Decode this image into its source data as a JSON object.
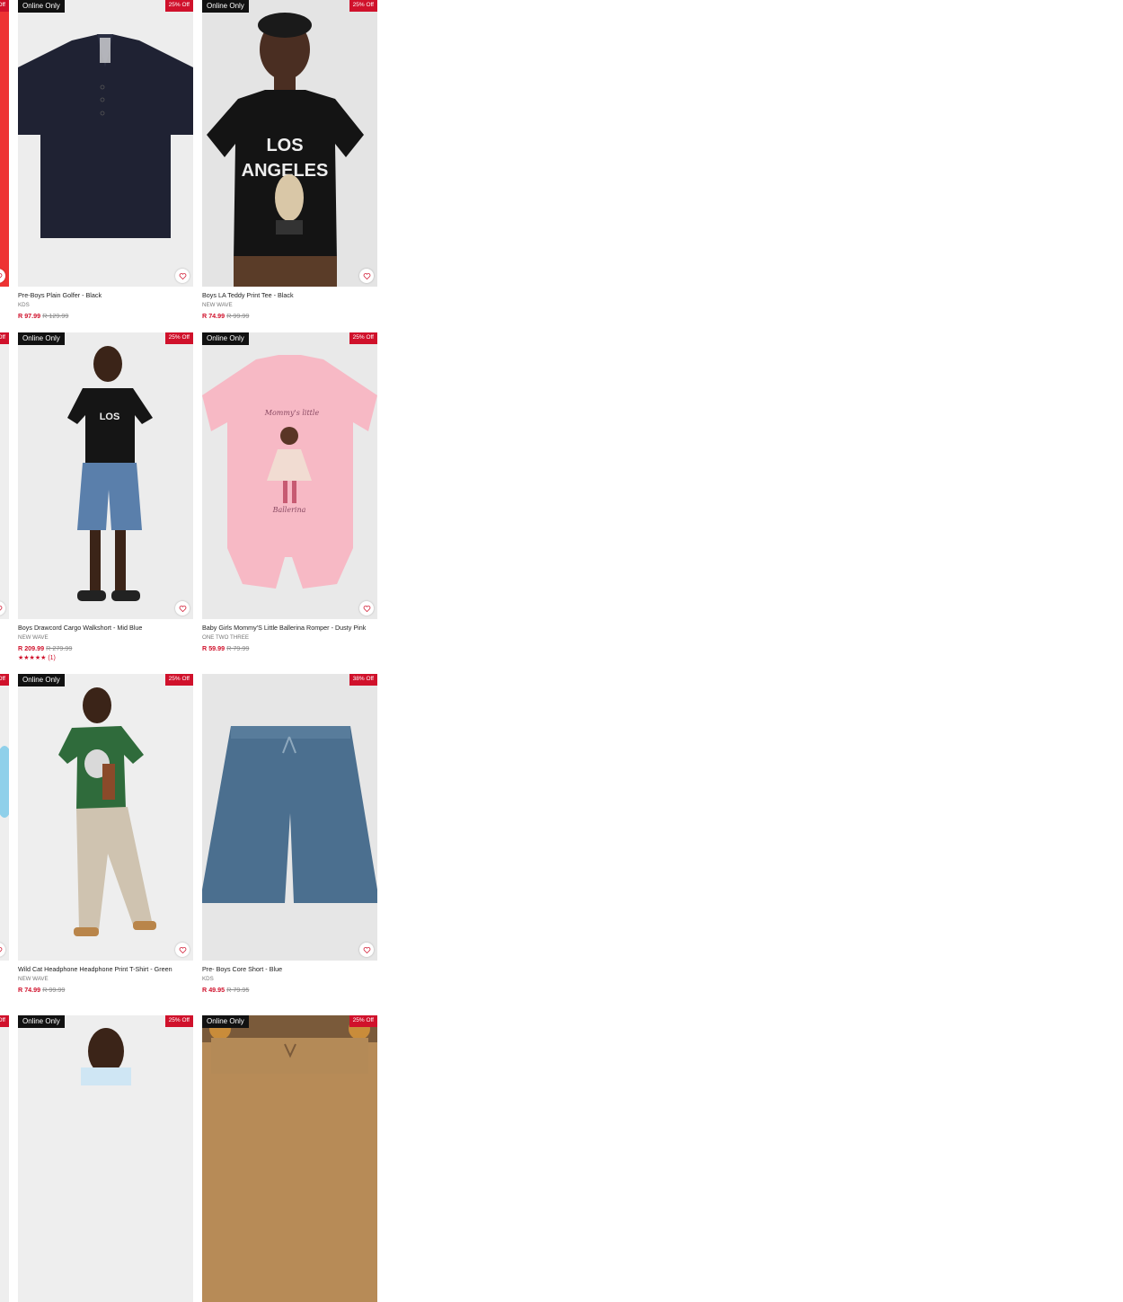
{
  "colors": {
    "accent": "#d0112b",
    "badge_bg": "#111111"
  },
  "products": [
    {
      "badge": "Online Only",
      "discount": "25% Off",
      "title": "Pre-Boys Plain Golfer - Black",
      "brand": "KDS",
      "price": "R 97.99",
      "was": "R 129.99",
      "image": "navy-polo-shirt"
    },
    {
      "badge": "Online Only",
      "discount": "25% Off",
      "title": "Boys LA Teddy Print Tee - Black",
      "brand": "NEW WAVE",
      "price": "R 74.99",
      "was": "R 99.99",
      "image": "boy-black-tee"
    },
    {
      "badge": "Online Only",
      "discount": "25% Off",
      "title": "Boys Drawcord Cargo Walkshort - Mid Blue",
      "brand": "NEW WAVE",
      "price": "R 209.99",
      "was": "R 279.99",
      "rating": "★★★★★ (1)",
      "image": "boy-denim-shorts"
    },
    {
      "badge": "Online Only",
      "discount": "25% Off",
      "title": "Baby Girls Mommy'S Little Ballerina Romper - Dusty Pink",
      "brand": "ONE TWO THREE",
      "price": "R 59.99",
      "was": "R 79.99",
      "image": "pink-romper"
    },
    {
      "badge": "Online Only",
      "discount": "25% Off",
      "title": "Wild Cat Headphone Headphone Print T-Shirt - Green",
      "brand": "NEW WAVE",
      "price": "R 74.99",
      "was": "R 99.99",
      "image": "boy-green-tee"
    },
    {
      "badge": "",
      "discount": "38% Off",
      "title": "Pre- Boys Core Short - Blue",
      "brand": "KDS",
      "price": "R 49.95",
      "was": "R 79.95",
      "image": "blue-shorts"
    },
    {
      "badge": "Online Only",
      "discount": "25% Off",
      "image": "boy-partial"
    },
    {
      "badge": "Online Only",
      "discount": "25% Off",
      "image": "khaki-pants-partial"
    }
  ],
  "left_column_discount": "Off"
}
